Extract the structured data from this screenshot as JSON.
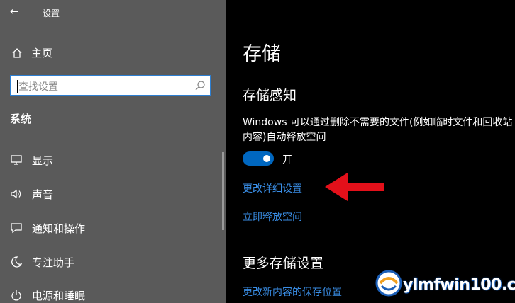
{
  "window": {
    "title": "设置"
  },
  "sidebar": {
    "home_label": "主页",
    "search": {
      "placeholder": "查找设置"
    },
    "section_label": "系统",
    "items": [
      {
        "label": "显示",
        "icon": "monitor-icon"
      },
      {
        "label": "声音",
        "icon": "speaker-icon"
      },
      {
        "label": "通知和操作",
        "icon": "message-icon"
      },
      {
        "label": "专注助手",
        "icon": "moon-icon"
      },
      {
        "label": "电源和睡眠",
        "icon": "power-icon"
      }
    ]
  },
  "main": {
    "page_title": "存储",
    "storage_sense": {
      "title": "存储感知",
      "description_line1": "Windows 可以通过删除不需要的文件(例如临时文件和回收站",
      "description_line2": "内容)自动释放空间",
      "toggle_state": "开",
      "toggle_on": true
    },
    "links": {
      "change_settings": "更改详细设置",
      "free_space_now": "立即释放空间"
    },
    "more_settings": {
      "title": "更多存储设置",
      "change_save_location": "更改新内容的保存位置"
    }
  },
  "colors": {
    "sidebar_bg": "#5a5a5a",
    "main_bg": "#000000",
    "accent": "#0067c0",
    "link": "#3a8ee6",
    "annotation_arrow": "#e3101a"
  },
  "watermark": {
    "text": "ylmfwin100.com"
  }
}
